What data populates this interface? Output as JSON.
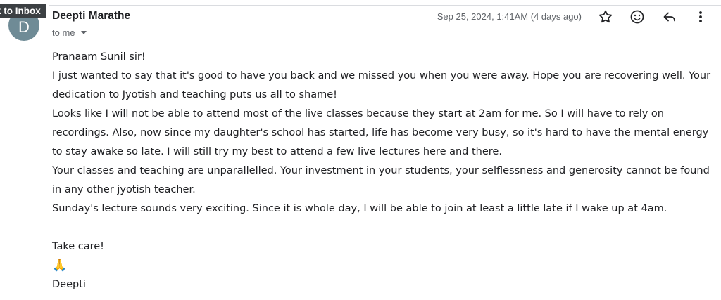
{
  "tooltip": "k to Inbox",
  "sender": {
    "avatar_letter": "D",
    "name": "Deepti Marathe",
    "recipient_label": "to me"
  },
  "header": {
    "date": "Sep 25, 2024, 1:41AM (4 days ago)"
  },
  "icons": {
    "star": "star-icon",
    "emoji": "add-reaction-icon",
    "reply": "reply-icon",
    "more": "more-vert-icon"
  },
  "body": {
    "greeting": "Pranaam Sunil sir!",
    "paragraphs": [
      "I just wanted to say that it's good to have you back and we missed you when you were away. Hope you are recovering well. Your dedication to Jyotish and teaching puts us all to shame!",
      "Looks like I will not be able to attend most of the live classes because they start at 2am for me. So I will have to rely on recordings. Also, now since my daughter's school has started, life has become very busy, so it's hard to have the mental energy to stay awake so late. I will still try my best to attend a few live lectures here and there.",
      "Your classes and teaching are unparallelled. Your investment in your students, your selflessness and generosity cannot be found in any other jyotish teacher.",
      "Sunday's lecture sounds very exciting. Since it is whole day, I will be able to join at least a little late if I wake up at 4am."
    ],
    "closing": "Take care!",
    "emoji": "🙏",
    "signature": "Deepti"
  }
}
